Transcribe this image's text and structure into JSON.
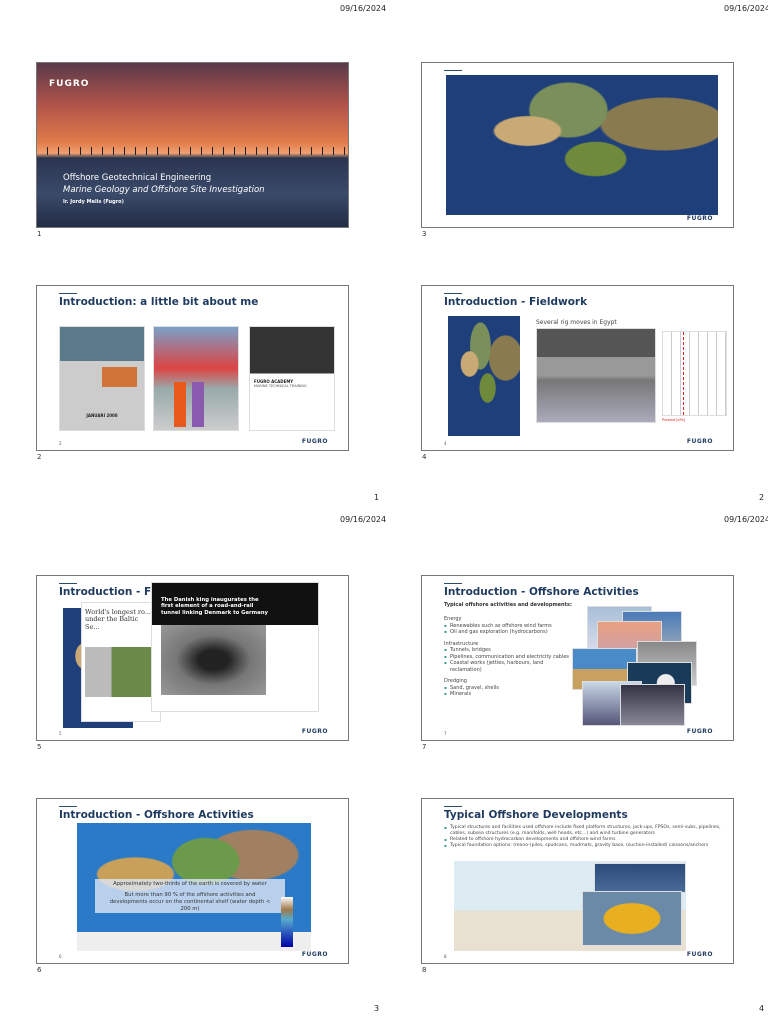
{
  "pages": [
    {
      "date": "09/16/2024",
      "page_number": "1"
    },
    {
      "date": "09/16/2024",
      "page_number": "2"
    },
    {
      "date": "09/16/2024",
      "page_number": "3"
    },
    {
      "date": "09/16/2024",
      "page_number": "4"
    }
  ],
  "slides": {
    "s1": {
      "number": "1",
      "logo": "FUGRO",
      "title": "Offshore Geotechnical Engineering",
      "subtitle": "Marine Geology and Offshore Site Investigation",
      "author": "Ir. Jordy Melis (Fugro)"
    },
    "s2": {
      "number": "2",
      "inner_number": "2",
      "title": "Introduction: a little bit about me",
      "calendar": "JANUARI 2008",
      "academy_title": "FUGRO ACADEMY",
      "academy_sub": "MARINE TECHNICAL TRAINING",
      "logo": "FUGRO"
    },
    "s3": {
      "number": "3",
      "logo": "FUGRO"
    },
    "s4": {
      "number": "4",
      "inner_number": "4",
      "title": "Introduction - Fieldwork",
      "caption": "Several rig moves in Egypt",
      "legend": "Preload [kPa]",
      "logo": "FUGRO"
    },
    "s5": {
      "number": "5",
      "inner_number": "5",
      "title": "Introduction - Fieldwork",
      "headline1": "World's longest ro... under the Baltic Se...",
      "headline2": "The Danish king inaugurates the first element of a road-and-rail tunnel linking Denmark to Germany",
      "logo": "FUGRO"
    },
    "s6": {
      "number": "6",
      "inner_number": "6",
      "title": "Introduction - Offshore Activities",
      "line1": "Approximately two-thirds of the earth is covered by water",
      "line2": "But more than 90 % of the offshore activities and developments occur on the continental shelf (water depth < 200 m)",
      "logo": "FUGRO"
    },
    "s7": {
      "number": "7",
      "inner_number": "7",
      "title": "Introduction - Offshore Activities",
      "intro": "Typical offshore activities and developments:",
      "groups": [
        {
          "heading": "Energy",
          "items": [
            "Renewables such as offshore wind farms",
            "Oil and gas exploration (hydrocarbons)"
          ]
        },
        {
          "heading": "Infrastructure",
          "items": [
            "Tunnels, bridges",
            "Pipelines, communication and electricity cables",
            "Coastal works (jetties, harbours, land reclamation)"
          ]
        },
        {
          "heading": "Dredging",
          "items": [
            "Sand, gravel, shells",
            "Minerals"
          ]
        }
      ],
      "logo": "FUGRO"
    },
    "s8": {
      "number": "8",
      "inner_number": "8",
      "title": "Typical Offshore Developments",
      "bullets": [
        "Typical structures and facilities used offshore include fixed platform structures, jack-ups, FPSOs, semi-subs, pipelines, cables, subsea structures (e.g. manifolds, well heads, etc...) and wind turbine generators",
        "Related to offshore hydrocarbon developments and offshore wind farms",
        "Typical foundation options: (mono-)piles, spudcans, mudmats, gravity base, (suction-installed) caissons/anchors"
      ],
      "logo": "FUGRO"
    }
  }
}
